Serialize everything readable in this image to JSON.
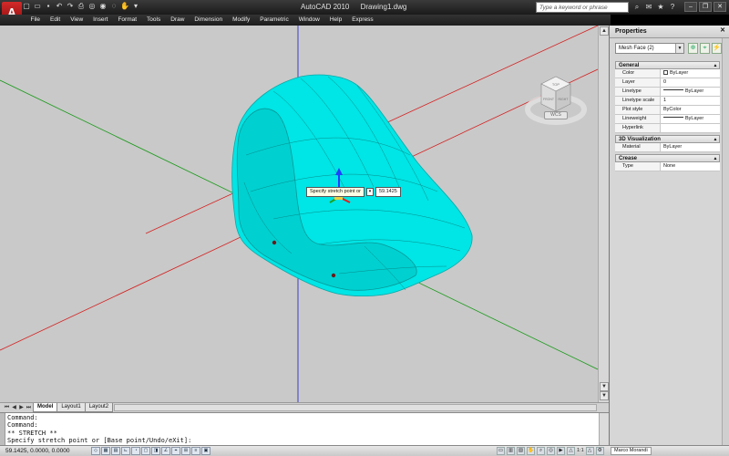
{
  "app": {
    "title": "AutoCAD 2010",
    "document": "Drawing1.dwg",
    "logo_letter": "A",
    "search_placeholder": "Type a keyword or phrase"
  },
  "menu": [
    "File",
    "Edit",
    "View",
    "Insert",
    "Format",
    "Tools",
    "Draw",
    "Dimension",
    "Modify",
    "Parametric",
    "Window",
    "Help",
    "Express"
  ],
  "viewport": {
    "background": "#c9c9c9",
    "mesh_color": "#00e5e5",
    "axis_colors": {
      "x": "#d62020",
      "y": "#1a9a1a",
      "z": "#3030c8"
    },
    "tooltip_prompt": "Specify stretch point or",
    "tooltip_value": "59.1425",
    "viewcube": {
      "face_top": "TOP",
      "face_front": "FRONT",
      "face_right": "RIGHT",
      "wcs_label": "WCS"
    }
  },
  "layout_tabs": [
    {
      "label": "Model",
      "active": true
    },
    {
      "label": "Layout1",
      "active": false
    },
    {
      "label": "Layout2",
      "active": false
    }
  ],
  "command_history": [
    "Command:",
    "Command:",
    "** STRETCH **",
    "Specify stretch point or [Base point/Undo/eXit]:"
  ],
  "status": {
    "coordinates": "59.1425, 0.0000, 0.0000",
    "annotation_scale": "1:1",
    "user": "Marco Morandi"
  },
  "properties": {
    "title": "Properties",
    "selection": "Mesh Face (2)",
    "sections": [
      {
        "name": "General",
        "rows": [
          {
            "key": "Color",
            "value": "ByLayer",
            "swatch": true
          },
          {
            "key": "Layer",
            "value": "0"
          },
          {
            "key": "Linetype",
            "value": "ByLayer",
            "line": true
          },
          {
            "key": "Linetype scale",
            "value": "1"
          },
          {
            "key": "Plot style",
            "value": "ByColor"
          },
          {
            "key": "Lineweight",
            "value": "ByLayer",
            "line": true
          },
          {
            "key": "Hyperlink",
            "value": ""
          }
        ]
      },
      {
        "name": "3D Visualization",
        "rows": [
          {
            "key": "Material",
            "value": "ByLayer"
          }
        ]
      },
      {
        "name": "Crease",
        "rows": [
          {
            "key": "Type",
            "value": "None"
          }
        ]
      }
    ]
  }
}
